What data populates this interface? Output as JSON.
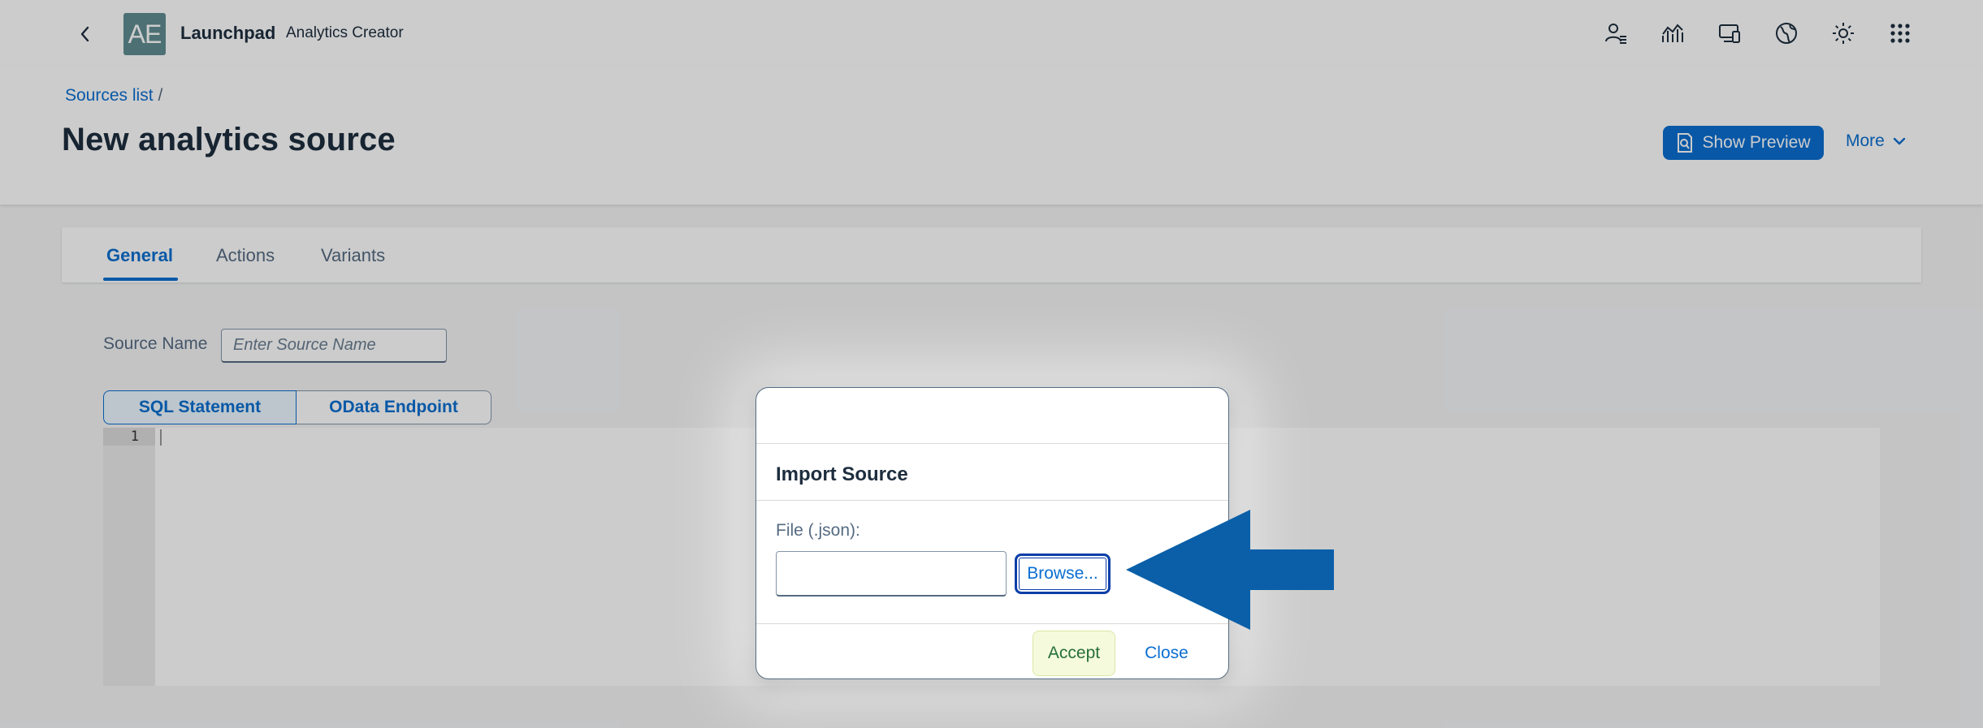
{
  "shell": {
    "logo_text": "AE",
    "title": "Launchpad",
    "subtitle": "Analytics Creator",
    "icons": [
      "user-settings-icon",
      "analytics-icon",
      "devices-icon",
      "globe-icon",
      "brightness-icon",
      "app-grid-icon"
    ]
  },
  "header": {
    "breadcrumb": "Sources list",
    "breadcrumb_sep": "/",
    "title": "New analytics source",
    "preview_label": "Show Preview",
    "more_label": "More"
  },
  "tabs": [
    {
      "label": "General",
      "active": true
    },
    {
      "label": "Actions",
      "active": false
    },
    {
      "label": "Variants",
      "active": false
    }
  ],
  "form": {
    "source_name_label": "Source Name",
    "source_name_placeholder": "Enter Source Name",
    "source_name_value": "",
    "segments": [
      "SQL Statement",
      "OData Endpoint"
    ],
    "editor_line": "1"
  },
  "dialog": {
    "title": "Import Source",
    "file_label": "File (.json):",
    "file_value": "",
    "browse_label": "Browse...",
    "accept_label": "Accept",
    "close_label": "Close"
  },
  "colors": {
    "accent": "#0a6ed1",
    "arrow": "#0a5fa8",
    "logo_bg": "#5f8d92",
    "accept_bg": "#f5fadc"
  }
}
